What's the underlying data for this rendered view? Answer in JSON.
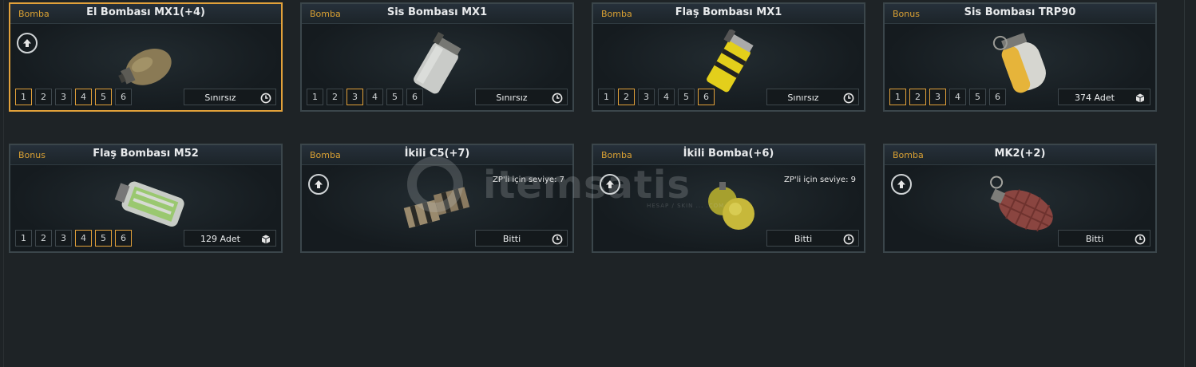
{
  "cards": [
    {
      "category": "Bomba",
      "title": "El Bombası MX1(+4)",
      "selected": true,
      "upgrade": true,
      "requirement": "",
      "levels": [
        {
          "n": "1",
          "on": true
        },
        {
          "n": "2",
          "on": false
        },
        {
          "n": "3",
          "on": false
        },
        {
          "n": "4",
          "on": true
        },
        {
          "n": "5",
          "on": true
        },
        {
          "n": "6",
          "on": false
        }
      ],
      "duration": "Sınırsız",
      "duration_icon": "clock-icon",
      "item_icon": "grenade-frag-brown"
    },
    {
      "category": "Bomba",
      "title": "Sis Bombası MX1",
      "selected": false,
      "upgrade": false,
      "requirement": "",
      "levels": [
        {
          "n": "1",
          "on": false
        },
        {
          "n": "2",
          "on": false
        },
        {
          "n": "3",
          "on": true
        },
        {
          "n": "4",
          "on": false
        },
        {
          "n": "5",
          "on": false
        },
        {
          "n": "6",
          "on": false
        }
      ],
      "duration": "Sınırsız",
      "duration_icon": "clock-icon",
      "item_icon": "smoke-grenade-white"
    },
    {
      "category": "Bomba",
      "title": "Flaş Bombası MX1",
      "selected": false,
      "upgrade": false,
      "requirement": "",
      "levels": [
        {
          "n": "1",
          "on": false
        },
        {
          "n": "2",
          "on": true
        },
        {
          "n": "3",
          "on": false
        },
        {
          "n": "4",
          "on": false
        },
        {
          "n": "5",
          "on": false
        },
        {
          "n": "6",
          "on": true
        }
      ],
      "duration": "Sınırsız",
      "duration_icon": "clock-icon",
      "item_icon": "flash-grenade-yellow"
    },
    {
      "category": "Bonus",
      "title": "Sis Bombası TRP90",
      "selected": false,
      "upgrade": false,
      "requirement": "",
      "levels": [
        {
          "n": "1",
          "on": true
        },
        {
          "n": "2",
          "on": true
        },
        {
          "n": "3",
          "on": true
        },
        {
          "n": "4",
          "on": false
        },
        {
          "n": "5",
          "on": false
        },
        {
          "n": "6",
          "on": false
        }
      ],
      "duration": "374 Adet",
      "duration_icon": "box-icon",
      "item_icon": "smoke-grenade-yellow"
    },
    {
      "category": "Bonus",
      "title": "Flaş Bombası M52",
      "selected": false,
      "upgrade": false,
      "requirement": "",
      "levels": [
        {
          "n": "1",
          "on": false
        },
        {
          "n": "2",
          "on": false
        },
        {
          "n": "3",
          "on": false
        },
        {
          "n": "4",
          "on": true
        },
        {
          "n": "5",
          "on": true
        },
        {
          "n": "6",
          "on": true
        }
      ],
      "duration": "129 Adet",
      "duration_icon": "box-icon",
      "item_icon": "flash-grenade-green"
    },
    {
      "category": "Bomba",
      "title": "İkili C5(+7)",
      "selected": false,
      "upgrade": true,
      "requirement": "ZP'li için seviye: 7",
      "levels": [],
      "duration": "Bitti",
      "duration_icon": "clock-icon",
      "item_icon": "c5-explosive"
    },
    {
      "category": "Bomba",
      "title": "İkili Bomba(+6)",
      "selected": false,
      "upgrade": true,
      "requirement": "ZP'li için seviye: 9",
      "levels": [],
      "duration": "Bitti",
      "duration_icon": "clock-icon",
      "item_icon": "dual-grenade-yellow"
    },
    {
      "category": "Bomba",
      "title": "MK2(+2)",
      "selected": false,
      "upgrade": true,
      "requirement": "",
      "levels": [],
      "duration": "Bitti",
      "duration_icon": "clock-icon",
      "item_icon": "grenade-mk2-red"
    }
  ],
  "watermark": {
    "text": "itemsatis",
    "subtext": "HESAP / SKIN ... .COM"
  }
}
